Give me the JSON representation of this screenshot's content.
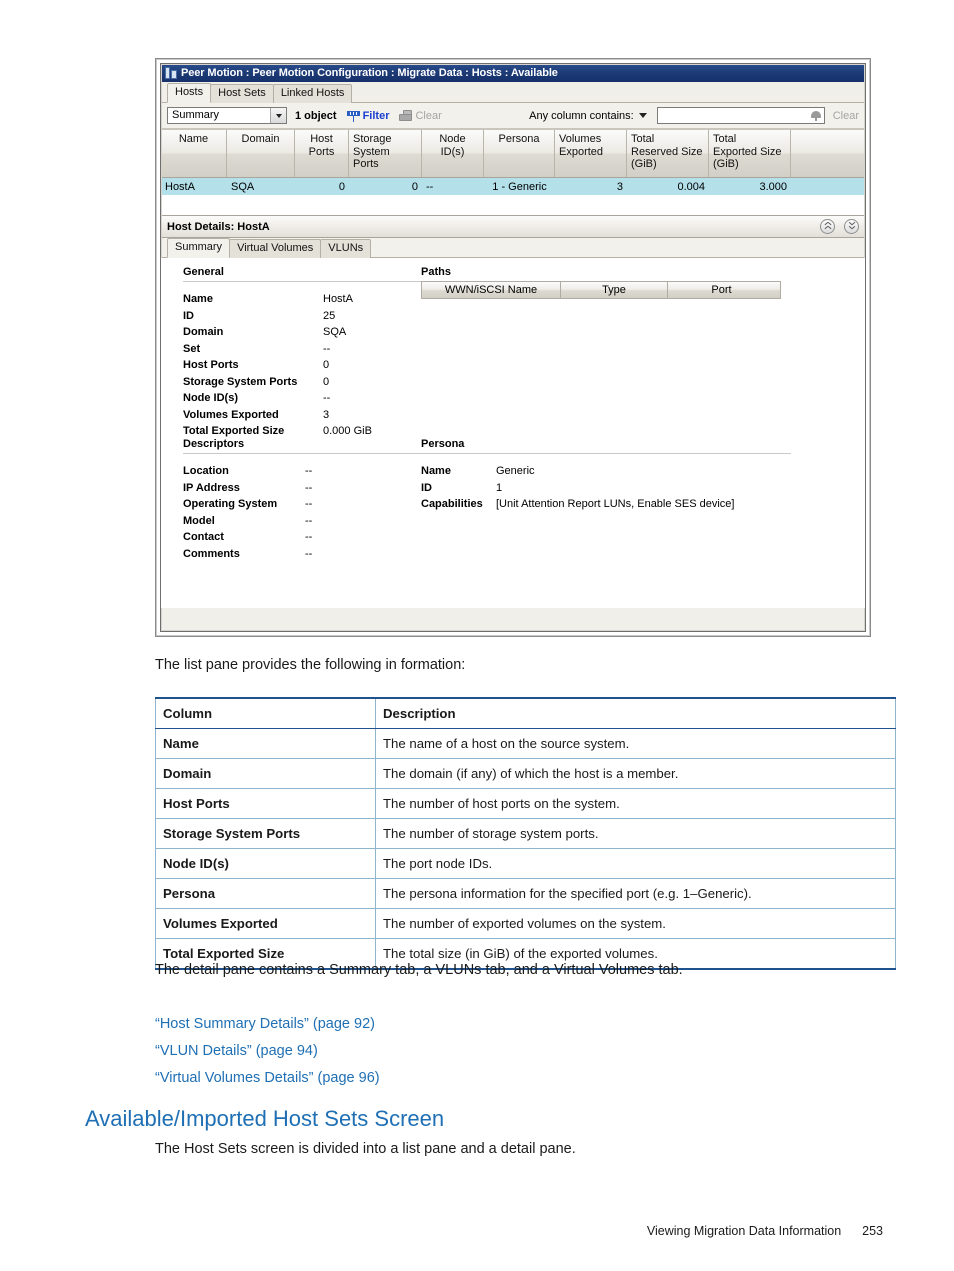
{
  "app_window": {
    "title": "Peer Motion : Peer Motion Configuration : Migrate Data : Hosts : Available",
    "title_icon": "server-icon",
    "tabs": [
      {
        "label": "Hosts",
        "active": true
      },
      {
        "label": "Host Sets",
        "active": false
      },
      {
        "label": "Linked Hosts",
        "active": false
      }
    ],
    "toolbar": {
      "view_select_value": "Summary",
      "object_count": "1 object",
      "filter_label": "Filter",
      "filter_icon": "filter-icon",
      "clear_label": "Clear",
      "clear_icon": "eraser-icon",
      "search_scope_label": "Any column contains:",
      "search_scope_caret": "chevron-down-icon",
      "search_value": "",
      "search_placeholder": "",
      "search_icon": "search-icon",
      "clear_search_label": "Clear"
    },
    "grid": {
      "columns": [
        "Name",
        "Domain",
        "Host Ports",
        "Storage\nSystem Ports",
        "Node ID(s)",
        "Persona",
        "Volumes\nExported",
        "Total\nReserved Size\n(GiB)",
        "Total\nExported Size\n(GiB)"
      ],
      "columns_display": [
        {
          "l1": "Name",
          "l2": "",
          "l3": ""
        },
        {
          "l1": "Domain",
          "l2": "",
          "l3": ""
        },
        {
          "l1": "Host Ports",
          "l2": "",
          "l3": ""
        },
        {
          "l1": "Storage",
          "l2": "System Ports",
          "l3": ""
        },
        {
          "l1": "Node ID(s)",
          "l2": "",
          "l3": ""
        },
        {
          "l1": "Persona",
          "l2": "",
          "l3": ""
        },
        {
          "l1": "Volumes",
          "l2": "Exported",
          "l3": ""
        },
        {
          "l1": "Total",
          "l2": "Reserved Size",
          "l3": "(GiB)"
        },
        {
          "l1": "Total",
          "l2": "Exported Size",
          "l3": "(GiB)"
        }
      ],
      "rows": [
        {
          "name": "HostA",
          "domain": "SQA",
          "host_ports": "0",
          "storage_system_ports": "0",
          "node_ids": "--",
          "persona": "1 - Generic",
          "volumes_exported": "3",
          "total_reserved_size": "0.004",
          "total_exported_size": "3.000",
          "selected": true
        }
      ],
      "selected_row_color": "#b4e0ea"
    },
    "detail": {
      "header": "Host Details: HostA",
      "collapse_icon": "chevron-double-up-icon",
      "expand_icon": "chevron-double-down-icon",
      "tabs": [
        {
          "label": "Summary",
          "active": true
        },
        {
          "label": "Virtual Volumes",
          "active": false
        },
        {
          "label": "VLUNs",
          "active": false
        }
      ],
      "general": {
        "title": "General",
        "rows": [
          {
            "key": "Name",
            "value": "HostA"
          },
          {
            "key": "ID",
            "value": "25"
          },
          {
            "key": "Domain",
            "value": "SQA"
          },
          {
            "key": "Set",
            "value": "--"
          },
          {
            "key": "Host Ports",
            "value": "0"
          },
          {
            "key": "Storage System Ports",
            "value": "0"
          },
          {
            "key": "Node ID(s)",
            "value": "--"
          },
          {
            "key": "Volumes Exported",
            "value": "3"
          },
          {
            "key": "Total Exported Size",
            "value": "0.000 GiB"
          }
        ]
      },
      "paths": {
        "title": "Paths",
        "columns": [
          "WWN/iSCSI Name",
          "Type",
          "Port"
        ],
        "rows": []
      },
      "descriptors": {
        "title": "Descriptors",
        "rows": [
          {
            "key": "Location",
            "value": "--"
          },
          {
            "key": "IP Address",
            "value": "--"
          },
          {
            "key": "Operating System",
            "value": "--"
          },
          {
            "key": "Model",
            "value": "--"
          },
          {
            "key": "Contact",
            "value": "--"
          },
          {
            "key": "Comments",
            "value": "--"
          }
        ]
      },
      "persona": {
        "title": "Persona",
        "rows": [
          {
            "key": "Name",
            "value": "Generic"
          },
          {
            "key": "ID",
            "value": "1"
          },
          {
            "key": "Capabilities",
            "value": "[Unit Attention Report LUNs, Enable SES device]"
          }
        ]
      }
    }
  },
  "document": {
    "intro_paragraph": "The list pane provides the following in formation:",
    "table": {
      "headers": [
        "Column",
        "Description"
      ],
      "rows": [
        {
          "column": "Name",
          "description": "The name of a host on the source system."
        },
        {
          "column": "Domain",
          "description": "The domain (if any) of which the host is a member."
        },
        {
          "column": "Host Ports",
          "description": "The number of host ports on the system."
        },
        {
          "column": "Storage System Ports",
          "description": "The number of storage system ports."
        },
        {
          "column": "Node ID(s)",
          "description": "The port node IDs."
        },
        {
          "column": "Persona",
          "description": "The persona information for the specified port (e.g. 1–Generic)."
        },
        {
          "column": "Volumes Exported",
          "description": "The number of exported volumes on the system."
        },
        {
          "column": "Total Exported Size",
          "description": "The total size (in GiB) of the exported volumes."
        }
      ]
    },
    "detail_paragraph": "The detail pane contains a Summary tab, a VLUNs tab, and a Virtual Volumes tab.",
    "links": [
      "“Host Summary Details” (page 92)",
      "“VLUN Details” (page 94)",
      "“Virtual Volumes Details” (page 96)"
    ],
    "heading": "Available/Imported Host Sets Screen",
    "closing_paragraph": "The Host Sets screen is divided into a list pane and a detail pane.",
    "footer": {
      "text": "Viewing Migration Data Information",
      "page_number": "253"
    }
  }
}
